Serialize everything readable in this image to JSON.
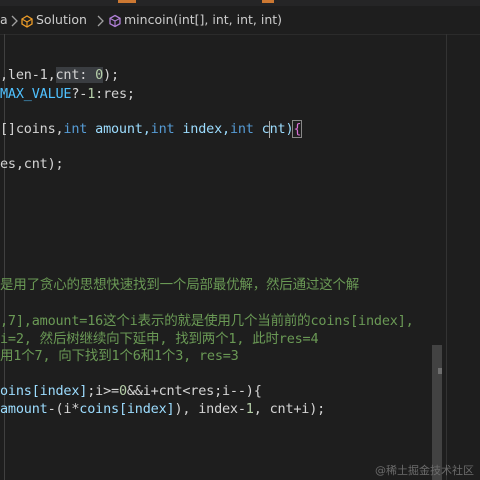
{
  "breadcrumb": {
    "class_segment": "Solution",
    "method_segment": "mincoin(int[], int, int, int)",
    "left_fragment": "a"
  },
  "code": {
    "l1": {
      "a": ",len-1,",
      "b": "cnt",
      "c": ": ",
      "d": "0",
      "e": ");"
    },
    "l2": {
      "a": "MAX_VALUE",
      "b": "?-",
      "c": "1",
      "d": ":res;"
    },
    "l3": {
      "a": "[]coins,",
      "b": "int",
      "c": " amount,",
      "d": "int",
      "e": " index,",
      "f": "int",
      "g": " cnt)",
      "h": "{"
    },
    "l4": {
      "a": "es,cnt);"
    },
    "c1": "是用了贪心的思想快速找到一个局部最优解，然后通过这个解",
    "c2": ",7],amount=16这个i表示的就是使用几个当前前的coins[index],",
    "c3": "i=2, 然后树继续向下延申, 找到两个1, 此时res=4",
    "c4": "用1个7, 向下找到1个6和1个3, res=3",
    "l5": {
      "a": "oins",
      "b": "[index]",
      "c": ";i>=",
      "d": "0",
      "e": "&&i+cnt<res;i--){"
    },
    "l6": {
      "a": "amount",
      "b": "-(i*",
      "c": "coins",
      "d": "[index]",
      "e": "), index-",
      "f": "1",
      "g": ", cnt+i);"
    }
  },
  "watermark": "@稀土掘金技术社区",
  "colors": {
    "background": "#1e1e1e",
    "keyword": "#569cd6",
    "variable": "#9cdcfe",
    "number": "#b5cea8",
    "comment": "#6a9955",
    "field": "#4fc1ff"
  }
}
